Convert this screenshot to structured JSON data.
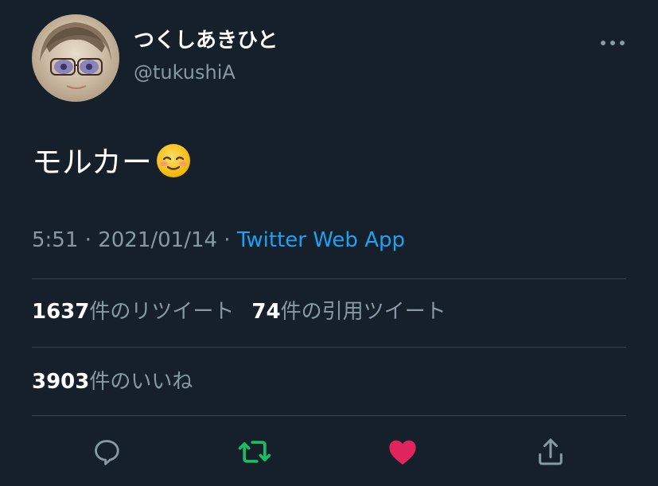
{
  "user": {
    "display_name": "つくしあきひと",
    "handle": "@tukushiA"
  },
  "tweet": {
    "text": "モルカー",
    "emoji": "smiling-face-emoji"
  },
  "meta": {
    "time": "5:51",
    "separator": " · ",
    "date": "2021/01/14",
    "source": "Twitter Web App"
  },
  "stats": {
    "retweets_count": "1637",
    "retweets_label": "件のリツイート",
    "quotes_count": "74",
    "quotes_label": "件の引用ツイート",
    "likes_count": "3903",
    "likes_label": "件のいいね"
  },
  "colors": {
    "background": "#15202b",
    "secondary_text": "#8899a6",
    "link": "#1da1f2",
    "retweet_active": "#17bf63",
    "like_active": "#e0245e",
    "divider": "#38444d"
  },
  "icons": {
    "more": "more-icon",
    "reply": "reply-icon",
    "retweet": "retweet-icon",
    "like": "heart-icon",
    "share": "share-icon"
  }
}
